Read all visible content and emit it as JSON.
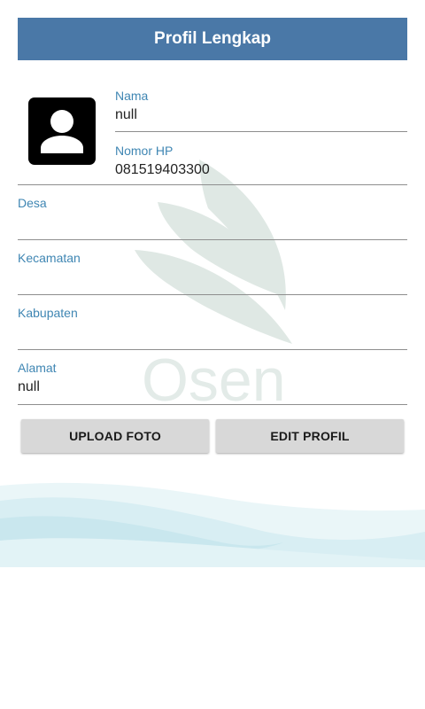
{
  "header": {
    "title": "Profil Lengkap"
  },
  "watermark": {
    "text": "Osen"
  },
  "avatar": {
    "icon": "person-icon"
  },
  "fields": {
    "nama": {
      "label": "Nama",
      "value": "null"
    },
    "nomor_hp": {
      "label": "Nomor HP",
      "value": "081519403300"
    },
    "desa": {
      "label": "Desa",
      "value": ""
    },
    "kecamatan": {
      "label": "Kecamatan",
      "value": ""
    },
    "kabupaten": {
      "label": "Kabupaten",
      "value": ""
    },
    "alamat": {
      "label": "Alamat",
      "value": "null"
    }
  },
  "buttons": {
    "upload_label": "UPLOAD FOTO",
    "edit_label": "EDIT PROFIL"
  },
  "colors": {
    "header_bg": "#4a78a7",
    "label": "#3f86b3",
    "button_bg": "#d8d8d8"
  }
}
